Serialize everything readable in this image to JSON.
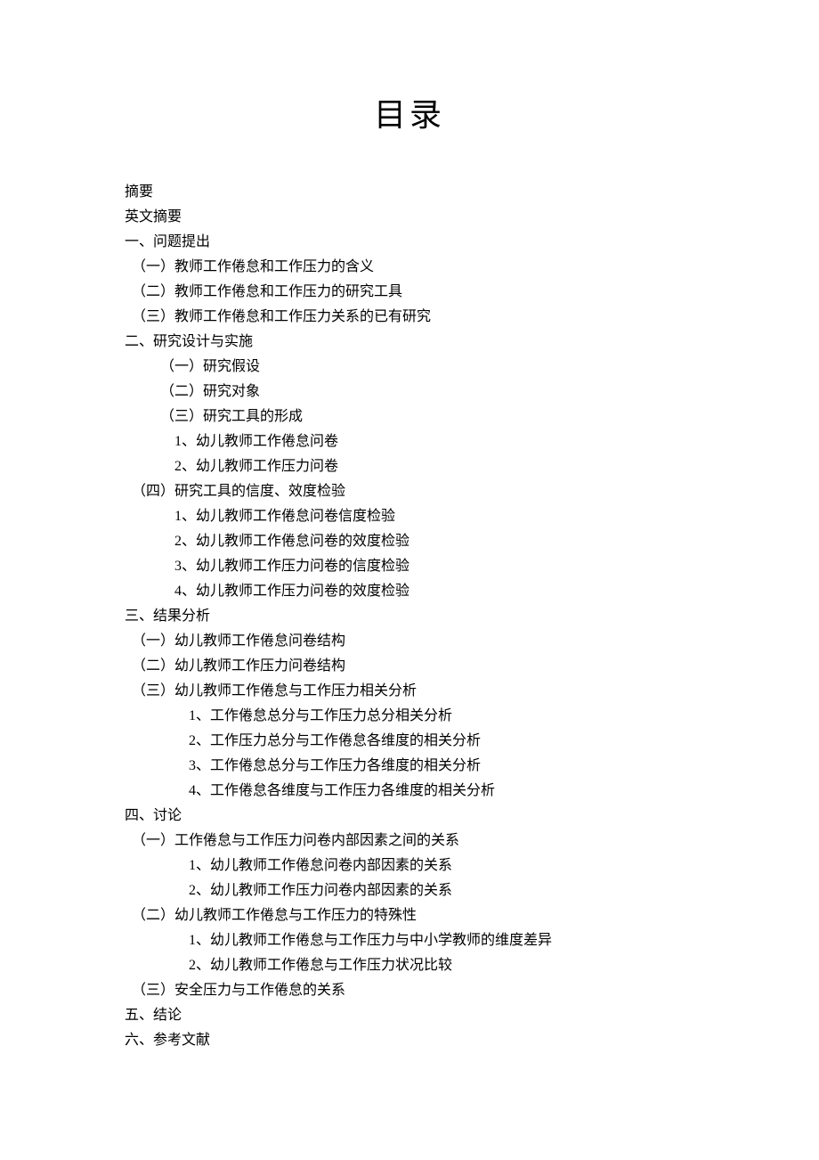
{
  "title": "目录",
  "entries": [
    {
      "text": "摘要",
      "level": "l0"
    },
    {
      "text": "英文摘要",
      "level": "l0"
    },
    {
      "text": "一、问题提出",
      "level": "l0"
    },
    {
      "text": "（一）教师工作倦怠和工作压力的含义",
      "level": "l1"
    },
    {
      "text": "（二）教师工作倦怠和工作压力的研究工具",
      "level": "l1"
    },
    {
      "text": "（三）教师工作倦怠和工作压力关系的已有研究",
      "level": "l1"
    },
    {
      "text": "二、研究设计与实施",
      "level": "l0"
    },
    {
      "text": "（一）研究假设",
      "level": "l2"
    },
    {
      "text": "（二）研究对象",
      "level": "l2"
    },
    {
      "text": "（三）研究工具的形成",
      "level": "l2"
    },
    {
      "text": "1、幼儿教师工作倦怠问卷",
      "level": "l3"
    },
    {
      "text": "2、幼儿教师工作压力问卷",
      "level": "l3"
    },
    {
      "text": "（四）研究工具的信度、效度检验",
      "level": "l1"
    },
    {
      "text": "1、幼儿教师工作倦怠问卷信度检验",
      "level": "l3"
    },
    {
      "text": "2、幼儿教师工作倦怠问卷的效度检验",
      "level": "l3"
    },
    {
      "text": "3、幼儿教师工作压力问卷的信度检验",
      "level": "l3"
    },
    {
      "text": "4、幼儿教师工作压力问卷的效度检验",
      "level": "l3"
    },
    {
      "text": "三、结果分析",
      "level": "l0"
    },
    {
      "text": "（一）幼儿教师工作倦怠问卷结构",
      "level": "l1"
    },
    {
      "text": "（二）幼儿教师工作压力问卷结构",
      "level": "l1"
    },
    {
      "text": "（三）幼儿教师工作倦怠与工作压力相关分析",
      "level": "l1"
    },
    {
      "text": "1、工作倦怠总分与工作压力总分相关分析",
      "level": "l4"
    },
    {
      "text": "2、工作压力总分与工作倦怠各维度的相关分析",
      "level": "l4"
    },
    {
      "text": "3、工作倦怠总分与工作压力各维度的相关分析",
      "level": "l4"
    },
    {
      "text": "4、工作倦怠各维度与工作压力各维度的相关分析",
      "level": "l4"
    },
    {
      "text": "四、讨论",
      "level": "l0"
    },
    {
      "text": "（一）工作倦怠与工作压力问卷内部因素之间的关系",
      "level": "l1"
    },
    {
      "text": "1、幼儿教师工作倦怠问卷内部因素的关系",
      "level": "l4"
    },
    {
      "text": "2、幼儿教师工作压力问卷内部因素的关系",
      "level": "l4"
    },
    {
      "text": "（二）幼儿教师工作倦怠与工作压力的特殊性",
      "level": "l1"
    },
    {
      "text": "1、幼儿教师工作倦怠与工作压力与中小学教师的维度差异",
      "level": "l4"
    },
    {
      "text": "2、幼儿教师工作倦怠与工作压力状况比较",
      "level": "l4"
    },
    {
      "text": "（三）安全压力与工作倦怠的关系",
      "level": "l1"
    },
    {
      "text": "五、结论",
      "level": "l0"
    },
    {
      "text": "六、参考文献",
      "level": "l0"
    }
  ]
}
